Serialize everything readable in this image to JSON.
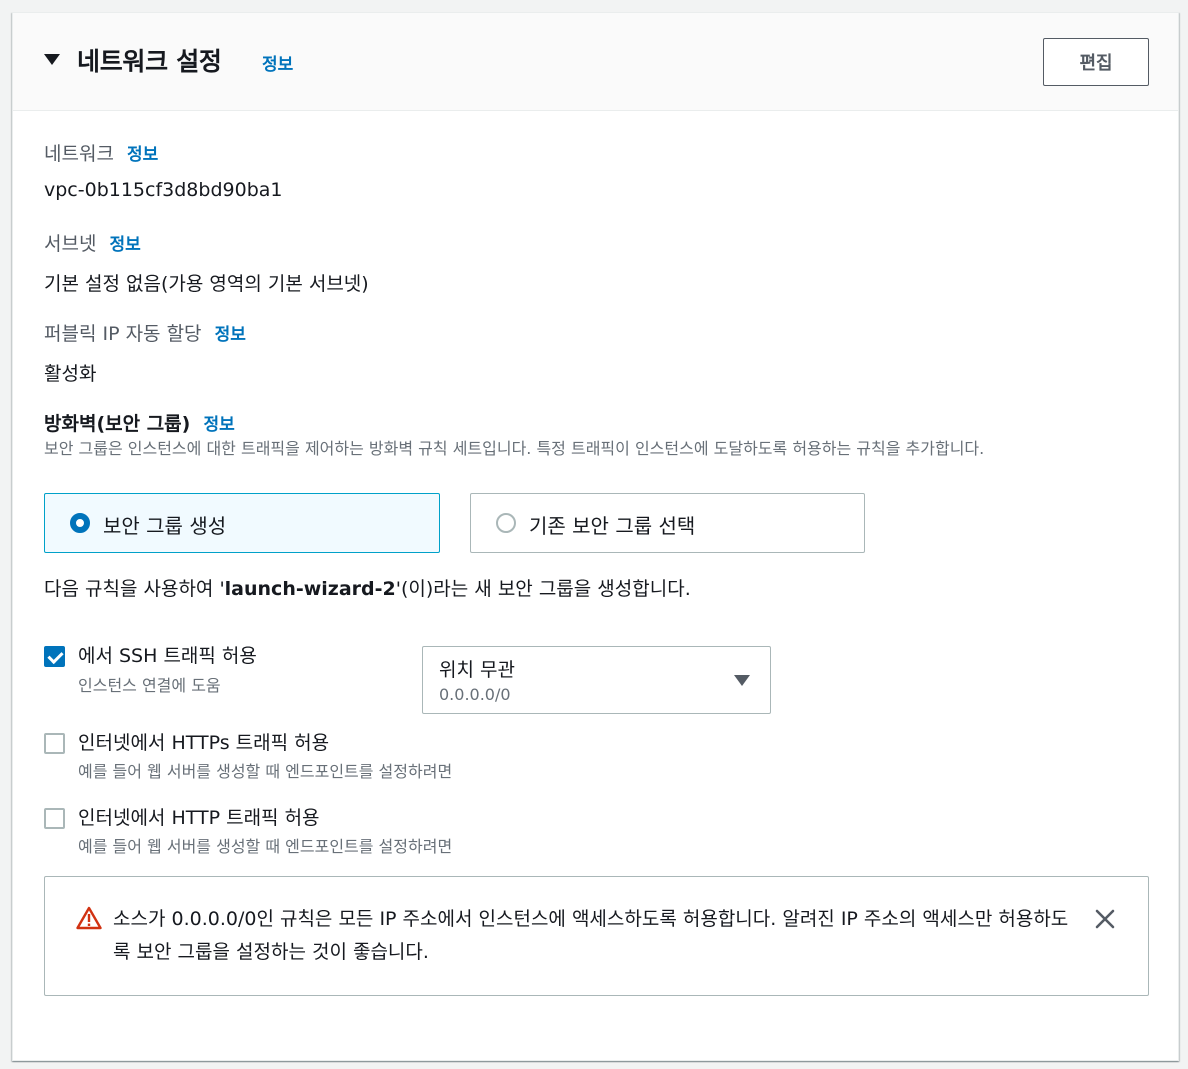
{
  "section": {
    "title": "네트워크 설정",
    "info": "정보",
    "edit_label": "편집"
  },
  "network": {
    "label": "네트워크",
    "info": "정보",
    "value": "vpc-0b115cf3d8bd90ba1"
  },
  "subnet": {
    "label": "서브넷",
    "info": "정보",
    "value": "기본 설정 없음(가용 영역의 기본 서브넷)"
  },
  "public_ip": {
    "label": "퍼블릭 IP 자동 할당",
    "info": "정보",
    "value": "활성화"
  },
  "firewall": {
    "label": "방화벽(보안 그룹)",
    "info": "정보",
    "description": "보안 그룹은 인스턴스에 대한 트래픽을 제어하는 방화벽 규칙 세트입니다. 특정 트래픽이 인스턴스에 도달하도록 허용하는 규칙을 추가합니다.",
    "options": [
      {
        "label": "보안 그룹 생성",
        "selected": true
      },
      {
        "label": "기존 보안 그룹 선택",
        "selected": false
      }
    ],
    "note_prefix": "다음 규칙을 사용하여 '",
    "note_name": "launch-wizard-2",
    "note_suffix": "'(이)라는 새 보안 그룹을 생성합니다."
  },
  "rules": [
    {
      "label": "에서 SSH 트래픽 허용",
      "description": "인스턴스 연결에 도움",
      "checked": true
    },
    {
      "label": "인터넷에서 HTTPs 트래픽 허용",
      "description": "예를 들어 웹 서버를 생성할 때 엔드포인트를 설정하려면",
      "checked": false
    },
    {
      "label": "인터넷에서 HTTP 트래픽 허용",
      "description": "예를 들어 웹 서버를 생성할 때 엔드포인트를 설정하려면",
      "checked": false
    }
  ],
  "source_select": {
    "value": "위치 무관",
    "sub": "0.0.0.0/0"
  },
  "alert": {
    "text": "소스가 0.0.0.0/0인 규칙은 모든 IP 주소에서 인스턴스에 액세스하도록 허용합니다. 알려진 IP 주소의 액세스만 허용하도록 보안 그룹을 설정하는 것이 좋습니다."
  },
  "colors": {
    "link": "#0073bb",
    "selected_bg": "#f1faff",
    "warning": "#d13212"
  }
}
